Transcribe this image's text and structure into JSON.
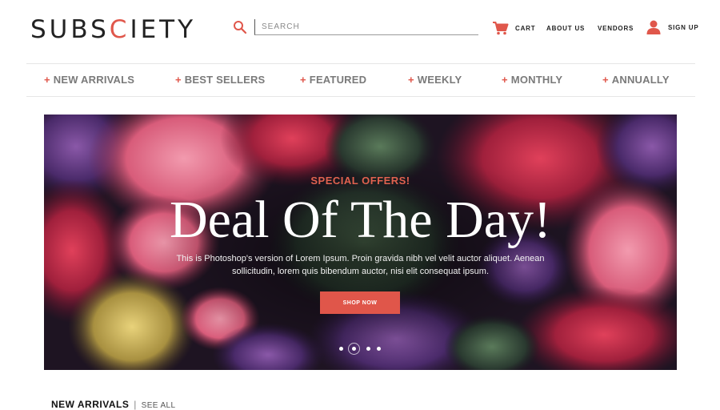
{
  "header": {
    "logo_prefix": "SUBS",
    "logo_accent": "C",
    "logo_suffix": "IETY",
    "search_placeholder": "SEARCH",
    "nav": {
      "cart": "CART",
      "about": "ABOUT US",
      "vendors": "VENDORS",
      "signup": "SIGN UP"
    }
  },
  "categories": [
    {
      "label": "NEW ARRIVALS"
    },
    {
      "label": "BEST SELLERS"
    },
    {
      "label": "FEATURED"
    },
    {
      "label": "WEEKLY"
    },
    {
      "label": "MONTHLY"
    },
    {
      "label": "ANNUALLY"
    }
  ],
  "hero": {
    "eyebrow": "SPECIAL OFFERS!",
    "title": "Deal Of The Day!",
    "body": "This is Photoshop's version  of Lorem Ipsum. Proin gravida nibh vel velit auctor aliquet. Aenean sollicitudin, lorem quis bibendum auctor, nisi elit consequat ipsum.",
    "cta": "SHOP NOW",
    "slides_total": 4,
    "active_slide": 2
  },
  "section": {
    "title": "NEW ARRIVALS",
    "link": "SEE ALL"
  },
  "colors": {
    "accent": "#e0574b",
    "nav_text": "#7a7a7a"
  },
  "icons": {
    "search": "search-icon",
    "cart": "cart-icon",
    "user": "user-icon"
  }
}
